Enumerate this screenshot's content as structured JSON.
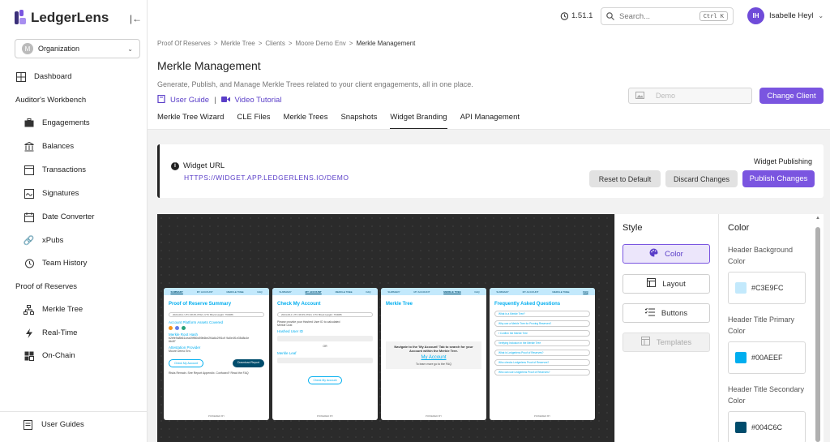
{
  "brand": {
    "name": "LedgerLens"
  },
  "sidebar": {
    "org_label": "Organization",
    "org_badge": "M",
    "dashboard": "Dashboard",
    "section_workbench": "Auditor's Workbench",
    "workbench_items": [
      "Engagements",
      "Balances",
      "Transactions",
      "Signatures",
      "Date Converter",
      "xPubs",
      "Team History"
    ],
    "section_reserves": "Proof of Reserves",
    "reserves_items": [
      "Merkle Tree",
      "Real-Time",
      "On-Chain"
    ],
    "user_guides": "User Guides"
  },
  "topbar": {
    "version": "1.51.1",
    "search_placeholder": "Search...",
    "search_shortcut": "Ctrl K",
    "user_initials": "IH",
    "user_name": "Isabelle Heyl"
  },
  "breadcrumb": [
    "Proof Of Reserves",
    "Merkle Tree",
    "Clients",
    "Moore Demo Env",
    "Merkle Management"
  ],
  "page": {
    "title": "Merkle Management",
    "subtitle": "Generate, Publish, and Manage Merkle Trees related to your client engagements, all in one place.",
    "user_guide": "User Guide",
    "video_tutorial": "Video Tutorial",
    "client_value": "Demo",
    "change_client": "Change Client"
  },
  "tabs": [
    {
      "label": "Merkle Tree Wizard",
      "active": false
    },
    {
      "label": "CLE Files",
      "active": false
    },
    {
      "label": "Merkle Trees",
      "active": false
    },
    {
      "label": "Snapshots",
      "active": false
    },
    {
      "label": "Widget Branding",
      "active": true
    },
    {
      "label": "API Management",
      "active": false
    }
  ],
  "widget": {
    "url_label": "Widget URL",
    "url": "HTTPS://WIDGET.APP.LEDGERLENS.IO/DEMO",
    "publishing_label": "Widget Publishing",
    "reset": "Reset to Default",
    "discard": "Discard Changes",
    "publish": "Publish Changes"
  },
  "preview": {
    "tabs": [
      "SUMMARY",
      "MY ACCOUNT",
      "MERKLE TREE",
      "FAQ"
    ],
    "card1": {
      "title": "Proof of Reserve Summary",
      "timestamp": "2024-06-1 UTC 08:45-3762 | UTC Block Height: 763086",
      "assets_label": "Account Platform Assets Covered",
      "root_label": "Merkle Root Hash",
      "root_hash": "b2efe9a8b61cea49ff80c59b6be2f4a6c2f91c9 9a0e4f1e35d8c4e6b4f7",
      "attestation_label": "Attestation Provider",
      "provider": "Moore Demo Env",
      "check_btn": "Check My Account",
      "download_btn": "Download Report",
      "footer_note": "Risks Remain. See Report Appendix. Confused? Read the FAQ",
      "powered": "POWERED BY"
    },
    "card2": {
      "title": "Check My Account",
      "timestamp": "2024-06-1 UTC 08:45-3762 | UTC Block Height: 763086",
      "intro": "Please provide your Hashed User ID to calculated Merkle Leaf.",
      "user_id_label": "Hashed User ID",
      "or": "OR",
      "leaf_label": "Merkle Leaf",
      "check_btn": "Check My Account",
      "powered": "POWERED BY"
    },
    "card3": {
      "title": "Merkle Tree",
      "message": "Navigate to the 'My Account' Tab to search for your Account within the Merkle Tree.",
      "link": "My Account",
      "learn": "To learn more go to the FAQ",
      "powered": "POWERED BY"
    },
    "card4": {
      "title": "Frequently Asked Questions",
      "items": [
        "What is a Merkle Tree?",
        "Why use a Merkle Tree for Proving Reserves?",
        "I Confirm the Merkle Tree",
        "Verifying Inclusion in the Merkle Tree",
        "What is Ledgerlens Proof of Reserves?",
        "Who checks Ledgerlens Proof of Reserves?",
        "Who can use Ledgerlens Proof of Reserves?"
      ],
      "powered": "POWERED BY"
    }
  },
  "style_panel": {
    "title": "Style",
    "buttons": [
      "Color",
      "Layout",
      "Buttons",
      "Templates"
    ]
  },
  "color_panel": {
    "title": "Color",
    "entries": [
      {
        "label": "Header Background Color",
        "value": "#C3E9FC",
        "color": "#C3E9FC"
      },
      {
        "label": "Header Title Primary Color",
        "value": "#00AEEF",
        "color": "#00AEEF"
      },
      {
        "label": "Header Title Secondary Color",
        "value": "#004C6C",
        "color": "#004C6C"
      }
    ]
  },
  "colors": {
    "accent": "#7a55e0",
    "dark": "#222222"
  }
}
